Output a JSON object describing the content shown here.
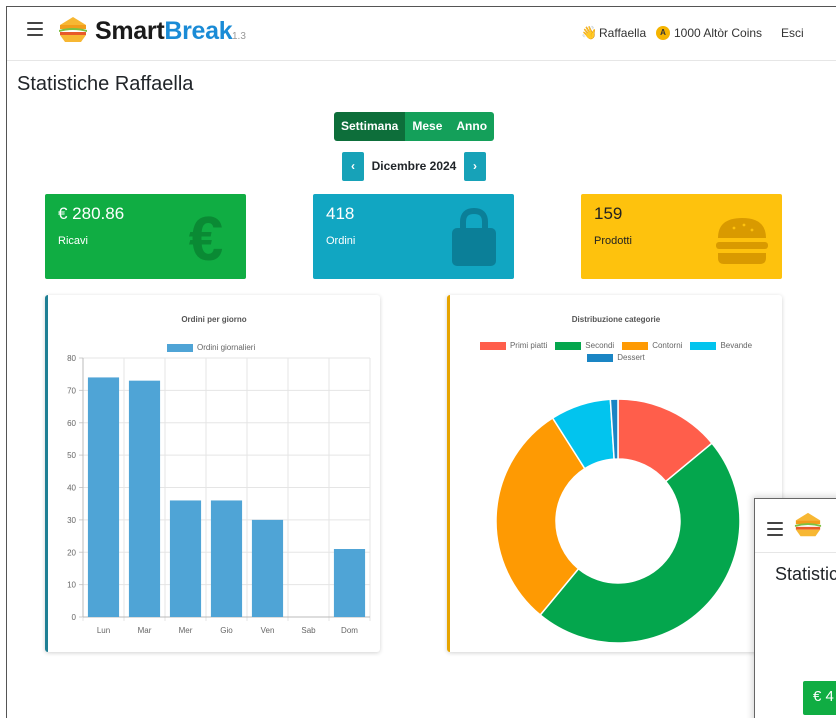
{
  "navbar": {
    "brand_part1": "Smart",
    "brand_part2": "Break",
    "version": "1.3",
    "user_name": "Raffaella",
    "coin_letter": "A",
    "coins": "1000 Altòr Coins",
    "logout": "Esci"
  },
  "page": {
    "title": "Statistiche Raffaella"
  },
  "period_toggle": {
    "week": "Settimana",
    "month": "Mese",
    "year": "Anno",
    "selected": "Settimana"
  },
  "month_nav": {
    "prev": "‹",
    "label": "Dicembre 2024",
    "next": "›"
  },
  "stats": [
    {
      "value": "€ 280.86",
      "label": "Ricavi",
      "icon": "euro-icon",
      "color": "#10ad43"
    },
    {
      "value": "418",
      "label": "Ordini",
      "icon": "shopping-bag-icon",
      "color": "#11a6c2"
    },
    {
      "value": "159",
      "label": "Prodotti",
      "icon": "burger-icon",
      "color": "#fec20d"
    }
  ],
  "chart_data": [
    {
      "type": "bar",
      "title": "Ordini per giorno",
      "categories": [
        "Lun",
        "Mar",
        "Mer",
        "Gio",
        "Ven",
        "Sab",
        "Dom"
      ],
      "series": [
        {
          "name": "Ordini giornalieri",
          "values": [
            74,
            73,
            36,
            36,
            30,
            0,
            21
          ],
          "color": "#4fa4d6"
        }
      ],
      "ylim": [
        0,
        80
      ],
      "yticks": [
        0,
        10,
        20,
        30,
        40,
        50,
        60,
        70,
        80
      ],
      "grid": true,
      "legend": "top"
    },
    {
      "type": "pie",
      "title": "Distribuzione categorie",
      "labels": [
        "Primi piatti",
        "Secondi",
        "Contorni",
        "Bevande",
        "Dessert"
      ],
      "values": [
        14,
        47,
        30,
        8,
        1
      ],
      "colors": [
        "#ff5e4b",
        "#04a64d",
        "#fe9a03",
        "#02c4ee",
        "#1a85c4"
      ],
      "donut": true,
      "legend": "top"
    }
  ],
  "overlay": {
    "title": "Statistiche Raffaella",
    "stat_value": "€ 4"
  }
}
